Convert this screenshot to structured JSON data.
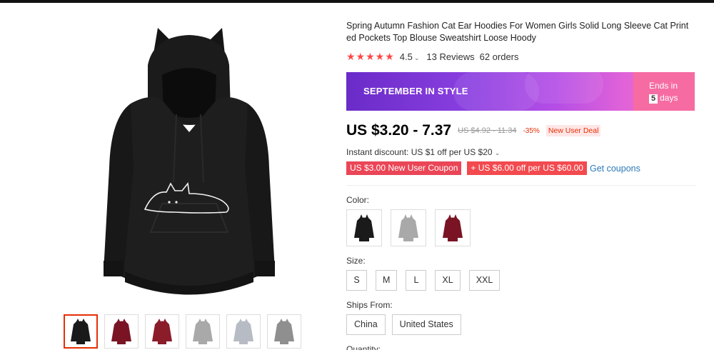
{
  "product": {
    "title": "Spring Autumn Fashion Cat Ear Hoodies For Women Girls Solid Long Sleeve Cat Print ed Pockets Top Blouse Sweatshirt Loose Hoody",
    "stars": "★★★★★",
    "rating": "4.5",
    "reviews": "13 Reviews",
    "orders": "62 orders"
  },
  "banner": {
    "title": "SEPTEMBER IN STYLE",
    "ends_label": "Ends in",
    "days_num": "5",
    "days_label": "days"
  },
  "price": {
    "current": "US $3.20 - 7.37",
    "original": "US $4.92 - 11.34",
    "discount": "-35%",
    "deal": "New User Deal"
  },
  "instant_discount": "Instant discount: US $1 off per US $20",
  "coupons": {
    "new_user": "US $3.00 New User Coupon",
    "extra": "+ US $6.00 off per US $60.00",
    "get": "Get coupons"
  },
  "color": {
    "label": "Color:",
    "options": [
      {
        "name": "black-hoodie",
        "color": "#1a1a1a"
      },
      {
        "name": "gray-hoodie",
        "color": "#a9a9a9"
      },
      {
        "name": "wine-red-hoodie",
        "color": "#7a1424"
      }
    ]
  },
  "size": {
    "label": "Size:",
    "options": [
      "S",
      "M",
      "L",
      "XL",
      "XXL"
    ]
  },
  "ships_from": {
    "label": "Ships From:",
    "options": [
      "China",
      "United States"
    ]
  },
  "quantity": {
    "label": "Quantity:"
  },
  "thumbnails": [
    {
      "name": "black",
      "color": "#1a1a1a"
    },
    {
      "name": "wine-red",
      "color": "#7a1424"
    },
    {
      "name": "wine-red-2",
      "color": "#8b1c2a"
    },
    {
      "name": "gray",
      "color": "#a9a9a9"
    },
    {
      "name": "light-gray",
      "color": "#b7bcc4"
    },
    {
      "name": "gray-detail",
      "color": "#8f8f8f"
    }
  ]
}
